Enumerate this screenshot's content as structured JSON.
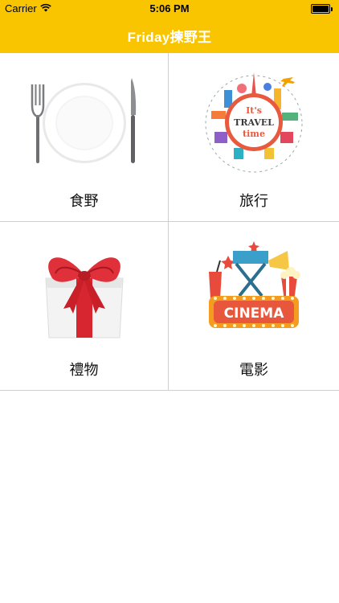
{
  "status": {
    "carrier": "Carrier",
    "time": "5:06 PM"
  },
  "nav": {
    "title": "Friday揀野王"
  },
  "tiles": [
    {
      "label": "食野",
      "icon": "plate-cutlery-icon"
    },
    {
      "label": "旅行",
      "icon": "travel-globe-icon",
      "art_text_1": "It's",
      "art_text_2": "TRAVEL",
      "art_text_3": "time"
    },
    {
      "label": "禮物",
      "icon": "gift-box-icon"
    },
    {
      "label": "電影",
      "icon": "cinema-icon",
      "art_text_1": "CINEMA"
    }
  ],
  "colors": {
    "accent": "#f9c500",
    "title_text": "#ffffff",
    "divider": "#cfcfcf"
  }
}
